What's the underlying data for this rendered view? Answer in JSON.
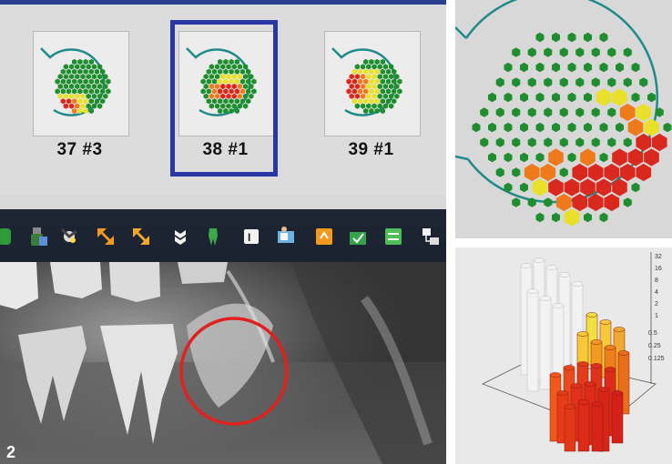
{
  "figure_number": "2",
  "thumbnails": [
    {
      "label": "37 #3",
      "selected": false
    },
    {
      "label": "38 #1",
      "selected": true
    },
    {
      "label": "39 #1",
      "selected": false
    }
  ],
  "toolbar_icons": [
    "shield-check-icon",
    "bottle-icon",
    "satellite-icon",
    "resize-arrows-icon",
    "resize-arrows-alt-icon",
    "share-icon",
    "tooth-icon",
    "tooth-chart-icon",
    "monitor-person-icon",
    "export-icon",
    "folder-check-icon",
    "transfer-icon",
    "network-icon"
  ],
  "bar_chart_axis_ticks": [
    "32",
    "16",
    "8",
    "4",
    "2",
    "1",
    "0.5",
    "0.25",
    "0.125"
  ],
  "colors": {
    "selection": "#2b36a6",
    "outline": "#1f8a8a",
    "green": "#1f8e2e",
    "yellow": "#e8e02a",
    "orange": "#ef7a1c",
    "red": "#d9281e",
    "circle_marker": "#e0211d"
  }
}
